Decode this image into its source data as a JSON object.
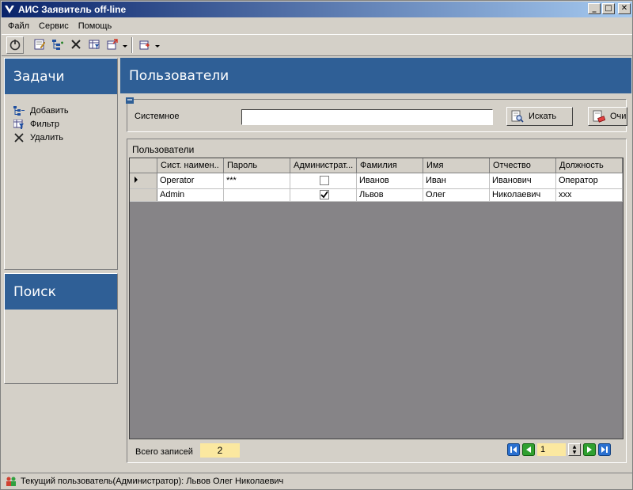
{
  "window": {
    "title": "АИС Заявитель off-line",
    "minimize_glyph": "_",
    "maximize_glyph": "□",
    "close_glyph": "✕"
  },
  "menu": {
    "items": [
      {
        "label": "Файл"
      },
      {
        "label": "Сервис"
      },
      {
        "label": "Помощь"
      }
    ]
  },
  "toolbar": {
    "icons": [
      "power-icon",
      "edit-icon",
      "add-icon",
      "delete-icon",
      "filter-icon",
      "export-icon",
      "import-icon"
    ]
  },
  "tasks": {
    "title": "Задачи",
    "items": [
      {
        "label": "Добавить",
        "icon": "add-icon"
      },
      {
        "label": "Фильтр",
        "icon": "filter-icon"
      },
      {
        "label": "Удалить",
        "icon": "delete-icon"
      }
    ]
  },
  "search": {
    "title": "Поиск"
  },
  "main": {
    "title": "Пользователи",
    "filter": {
      "label": "Системное",
      "value": "",
      "search_button": "Искать",
      "clear_button": "Очи"
    },
    "grid": {
      "title": "Пользователи",
      "columns": [
        "Сист. наимен..",
        "Пароль",
        "Администрат...",
        "Фамилия",
        "Имя",
        "Отчество",
        "Должность"
      ],
      "rows": [
        {
          "login": "Operator",
          "password": "***",
          "admin": false,
          "last_name": "Иванов",
          "first_name": "Иван",
          "middle_name": "Иванович",
          "position": "Оператор",
          "current": true
        },
        {
          "login": "Admin",
          "password": "",
          "admin": true,
          "last_name": "Львов",
          "first_name": "Олег",
          "middle_name": "Николаевич",
          "position": "ххх",
          "current": false
        }
      ]
    },
    "footer": {
      "total_label": "Всего записей",
      "total_value": "2",
      "page": "1"
    }
  },
  "status": {
    "text": "Текущий пользователь(Администратор): Львов Олег Николаевич"
  },
  "colors": {
    "header_blue": "#2f5f96",
    "grid_empty": "#868487",
    "highlight_yellow": "#fbe8a0"
  }
}
